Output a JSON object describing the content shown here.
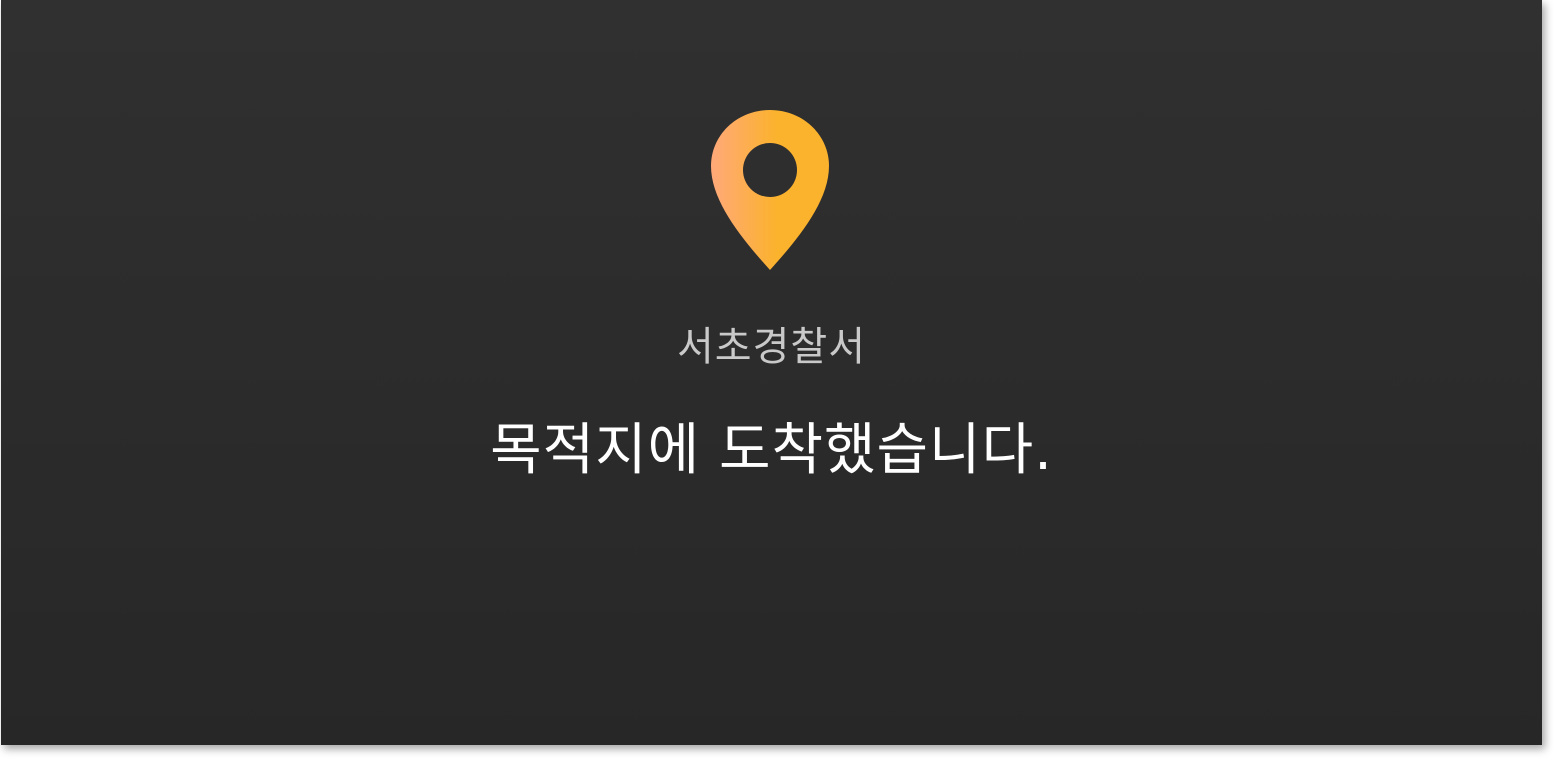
{
  "icon": {
    "name": "map-pin-icon",
    "gradient_start": "#ffa97a",
    "gradient_end": "#fbb22d"
  },
  "colors": {
    "background": "#2c2c2c",
    "primary_text": "#ffffff",
    "secondary_text": "#c9c9c9"
  },
  "destination": {
    "name": "서초경찰서"
  },
  "message": {
    "arrival": "목적지에 도착했습니다."
  }
}
